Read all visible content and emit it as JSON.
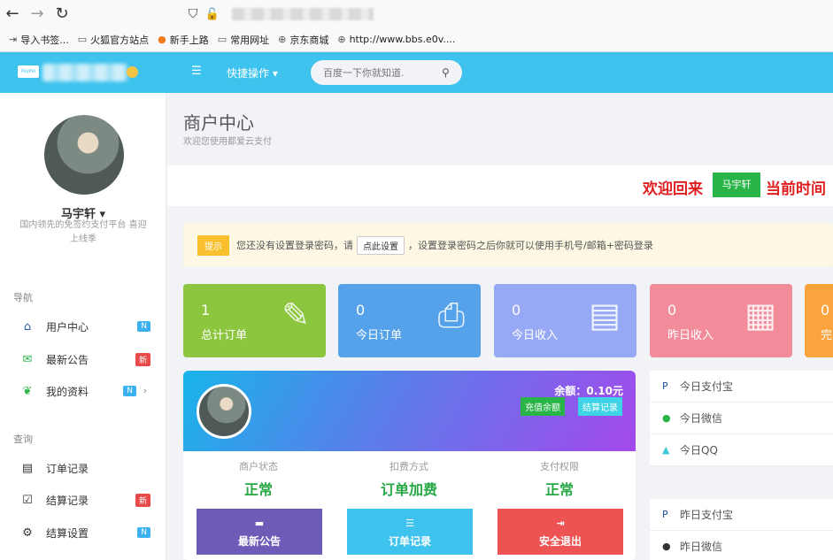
{
  "browser": {
    "bookmarks": [
      {
        "icon": "import-icon",
        "label": "导入书签..."
      },
      {
        "icon": "folder-icon",
        "label": "火狐官方站点"
      },
      {
        "icon": "firefox-icon",
        "label": "新手上路"
      },
      {
        "icon": "folder-icon",
        "label": "常用网址"
      },
      {
        "icon": "globe-icon",
        "label": "京东商城"
      },
      {
        "icon": "globe-icon",
        "label": "http://www.bbs.e0v...."
      }
    ]
  },
  "header": {
    "logo_text": "PayPal",
    "quick_ops": "快捷操作 ▾",
    "search_placeholder": "百度一下你就知道."
  },
  "sidebar": {
    "user_name": "马宇轩 ▾",
    "user_sub": "国内领先的免签约支付平台 喜迎上线季",
    "nav_label": "导航",
    "query_label": "查询",
    "nav_items": [
      {
        "label": "用户中心",
        "badge": "N",
        "badge_color": "blue",
        "icon": "home-icon",
        "icon_color": "#2c5aa0"
      },
      {
        "label": "最新公告",
        "badge": "新",
        "badge_color": "red",
        "icon": "mail-icon",
        "icon_color": "#28b446"
      },
      {
        "label": "我的资料",
        "badge": "N",
        "badge_color": "blue",
        "icon": "leaf-icon",
        "icon_color": "#28b446"
      }
    ],
    "query_items": [
      {
        "label": "订单记录",
        "badge": "",
        "badge_color": "",
        "icon": "list-icon",
        "icon_color": "#333"
      },
      {
        "label": "结算记录",
        "badge": "新",
        "badge_color": "red",
        "icon": "check-icon",
        "icon_color": "#333"
      },
      {
        "label": "结算设置",
        "badge": "N",
        "badge_color": "blue",
        "icon": "gears-icon",
        "icon_color": "#333"
      }
    ]
  },
  "main": {
    "title": "商户中心",
    "subtitle": "欢迎您使用都爱云支付",
    "welcome_prefix": "欢迎回来",
    "welcome_name": "马宇轩",
    "welcome_suffix": "当前时间",
    "notice": {
      "tag": "提示",
      "text1": "您还没有设置登录密码，请",
      "button": "点此设置",
      "text2": "，设置登录密码之后你就可以使用手机号/邮箱+密码登录"
    },
    "stats": [
      {
        "value": "1",
        "label": "总计订单",
        "icon": "question-edit-icon",
        "color": "#8cc63f"
      },
      {
        "value": "0",
        "label": "今日订单",
        "icon": "printer-icon",
        "color": "#55a2ea"
      },
      {
        "value": "0",
        "label": "今日收入",
        "icon": "document-icon",
        "color": "#97a8f5"
      },
      {
        "value": "0",
        "label": "昨日收入",
        "icon": "calendar-icon",
        "color": "#f28b9a"
      },
      {
        "value": "0",
        "label": "完",
        "icon": "",
        "color": "#fba33c"
      }
    ],
    "profile": {
      "balance_label": "余额：0.10元",
      "recharge": "充值余额",
      "settle": "结算记录",
      "info": [
        {
          "key": "商户状态",
          "value": "正常"
        },
        {
          "key": "扣费方式",
          "value": "订单加费"
        },
        {
          "key": "支付权限",
          "value": "正常"
        }
      ],
      "actions": [
        {
          "label": "最新公告",
          "icon": "card-icon",
          "color": "#6e5bb8"
        },
        {
          "label": "订单记录",
          "icon": "list-icon",
          "color": "#3dc3ee"
        },
        {
          "label": "安全退出",
          "icon": "logout-icon",
          "color": "#ed5353"
        }
      ]
    },
    "today_list": [
      {
        "label": "今日支付宝",
        "icon": "paypal-icon",
        "icon_color": "#1f4fa3"
      },
      {
        "label": "今日微信",
        "icon": "wechat-icon",
        "icon_color": "#28b446"
      },
      {
        "label": "今日QQ",
        "icon": "qq-icon",
        "icon_color": "#3cc8d6"
      }
    ],
    "yesterday_list": [
      {
        "label": "昨日支付宝",
        "icon": "paypal-icon",
        "icon_color": "#1f4fa3"
      },
      {
        "label": "昨日微信",
        "icon": "wechat-icon",
        "icon_color": "#333"
      }
    ]
  }
}
